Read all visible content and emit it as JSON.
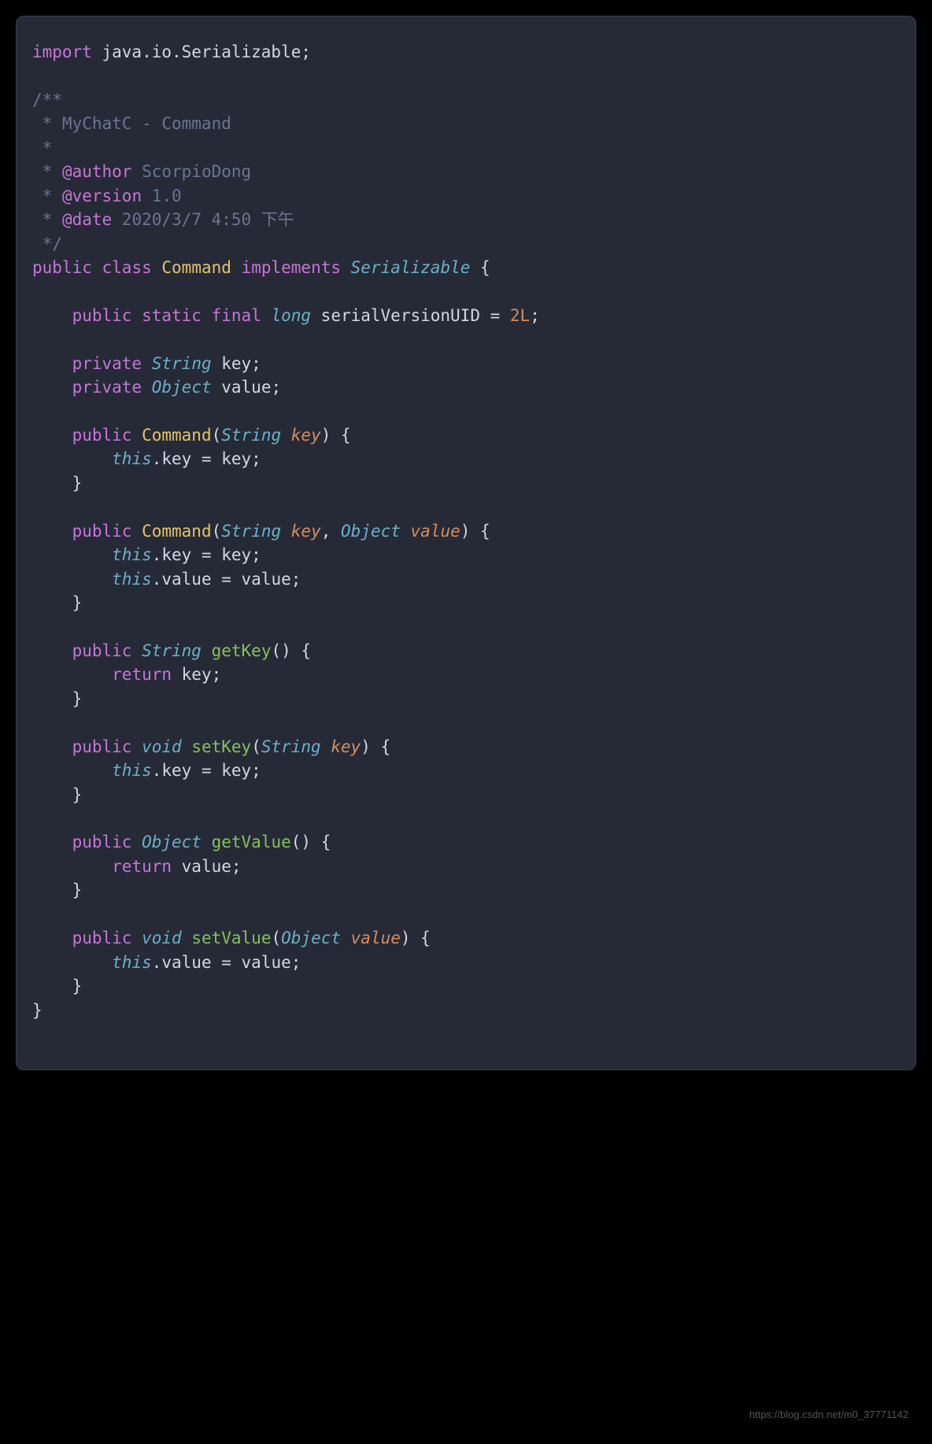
{
  "code": {
    "line1": {
      "kw": "import",
      "pkg": " java.io.Serializable;"
    },
    "doc_open": "/**",
    "doc_desc": " * MyChatC - Command",
    "doc_star": " *",
    "doc_author_tag": "@author",
    "doc_author_val": " ScorpioDong",
    "doc_version_tag": "@version",
    "doc_version_val": " 1.0",
    "doc_date_tag": "@date",
    "doc_date_val": " 2020/3/7 4:50 下午",
    "doc_close": " */",
    "decl": {
      "public": "public",
      "class": "class",
      "name": "Command",
      "implements": "implements",
      "iface": "Serializable",
      "brace": " {"
    },
    "field_uid": {
      "mods": "public static final",
      "type": "long",
      "name": " serialVersionUID = ",
      "val": "2L",
      "semi": ";"
    },
    "field_key": {
      "mod": "private",
      "type": "String",
      "name": " key;"
    },
    "field_val": {
      "mod": "private",
      "type": "Object",
      "name": " value;"
    },
    "ctor1": {
      "mod": "public",
      "name": "Command",
      "open": "(",
      "ptype": "String",
      "pname": "key",
      "close": ") {",
      "body_this": "this",
      "body_rest": ".key = key;",
      "end": "}"
    },
    "ctor2": {
      "mod": "public",
      "name": "Command",
      "open": "(",
      "ptype1": "String",
      "pname1": "key",
      "comma": ", ",
      "ptype2": "Object",
      "pname2": "value",
      "close": ") {",
      "l1_this": "this",
      "l1_rest": ".key = key;",
      "l2_this": "this",
      "l2_rest": ".value = value;",
      "end": "}"
    },
    "getkey": {
      "mod": "public",
      "ret": "String",
      "name": "getKey",
      "sig": "() {",
      "ret_kw": "return",
      "ret_val": " key;",
      "end": "}"
    },
    "setkey": {
      "mod": "public",
      "ret": "void",
      "name": "setKey",
      "open": "(",
      "ptype": "String",
      "pname": "key",
      "close": ") {",
      "this": "this",
      "rest": ".key = key;",
      "end": "}"
    },
    "getval": {
      "mod": "public",
      "ret": "Object",
      "name": "getValue",
      "sig": "() {",
      "ret_kw": "return",
      "ret_val": " value;",
      "end": "}"
    },
    "setval": {
      "mod": "public",
      "ret": "void",
      "name": "setValue",
      "open": "(",
      "ptype": "Object",
      "pname": "value",
      "close": ") {",
      "this": "this",
      "rest": ".value = value;",
      "end": "}"
    },
    "class_end": "}"
  },
  "watermark": "https://blog.csdn.net/m0_37771142"
}
